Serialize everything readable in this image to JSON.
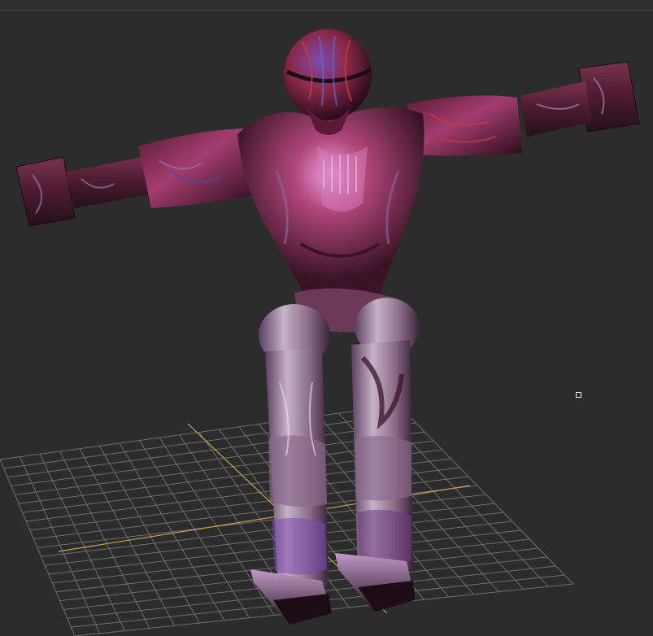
{
  "viewport": {
    "background": "#2c2c2c",
    "grid_color": "#7a7a7a",
    "axis_color": "#c9a24a",
    "content": "3d-character-model"
  },
  "model": {
    "palette": [
      "#3a1426",
      "#6b2446",
      "#a33d6e",
      "#c77ac0",
      "#d8c8d8",
      "#1c0c16"
    ]
  },
  "icons": {
    "pivot": "square-marker-icon"
  }
}
